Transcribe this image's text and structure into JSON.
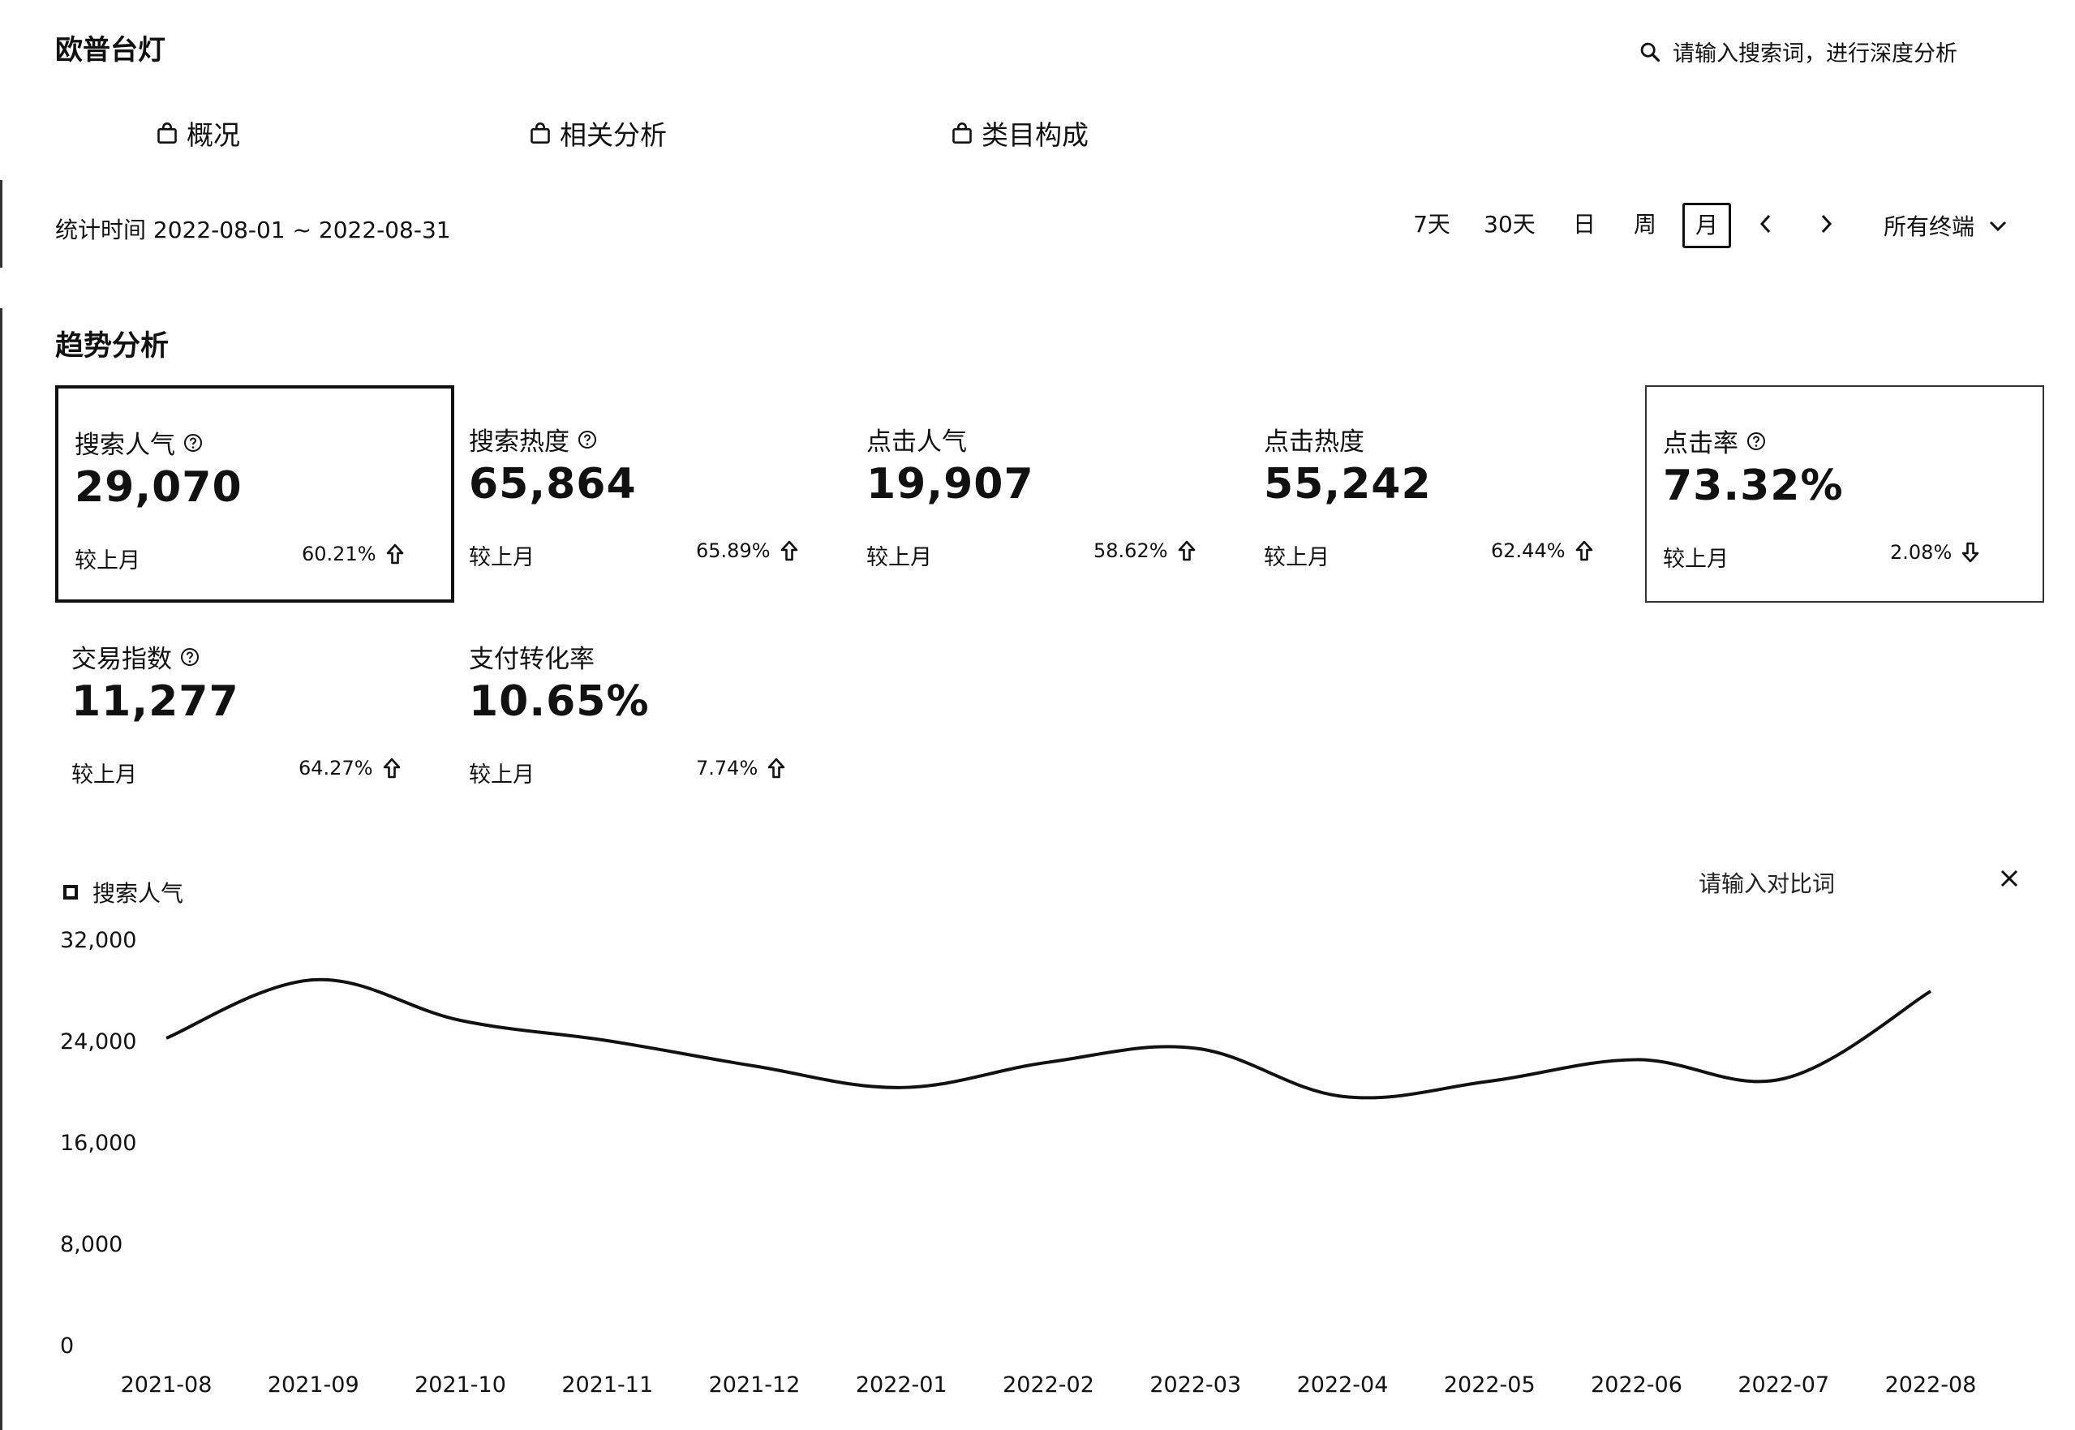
{
  "app": {
    "title": "欧普台灯"
  },
  "search": {
    "placeholder": "请输入搜索词，进行深度分析"
  },
  "tabs": [
    {
      "label": "概况",
      "icon": "shopping-bag-icon"
    },
    {
      "label": "相关分析",
      "icon": "shopping-bag-icon"
    },
    {
      "label": "类目构成",
      "icon": "shopping-bag-icon"
    }
  ],
  "toolbar": {
    "date_range": "统计时间 2022-08-01 ~ 2022-08-31",
    "periods": [
      "7天",
      "30天",
      "日",
      "周",
      "月"
    ],
    "active_period": "月",
    "terminal": "所有终端"
  },
  "section": {
    "title": "趋势分析"
  },
  "metrics": [
    {
      "label": "搜索人气",
      "value": "29,070",
      "compare": "较上月",
      "change": "60.21%",
      "direction": "up",
      "help": true,
      "selected": "primary"
    },
    {
      "label": "搜索热度",
      "value": "65,864",
      "compare": "较上月",
      "change": "65.89%",
      "direction": "up",
      "help": true,
      "selected": "none"
    },
    {
      "label": "点击人气",
      "value": "19,907",
      "compare": "较上月",
      "change": "58.62%",
      "direction": "up",
      "help": false,
      "selected": "none"
    },
    {
      "label": "点击热度",
      "value": "55,242",
      "compare": "较上月",
      "change": "62.44%",
      "direction": "up",
      "help": false,
      "selected": "none"
    },
    {
      "label": "点击率",
      "value": "73.32%",
      "compare": "较上月",
      "change": "2.08%",
      "direction": "down",
      "help": true,
      "selected": "secondary"
    },
    {
      "label": "交易指数",
      "value": "11,277",
      "compare": "较上月",
      "change": "64.27%",
      "direction": "up",
      "help": true,
      "selected": "none"
    },
    {
      "label": "支付转化率",
      "value": "10.65%",
      "compare": "较上月",
      "change": "7.74%",
      "direction": "up",
      "help": false,
      "selected": "none"
    }
  ],
  "chart_controls": {
    "legend_label": "搜索人气",
    "compare_placeholder": "请输入对比词"
  },
  "chart_data": {
    "type": "line",
    "x": [
      "2021-08",
      "2021-09",
      "2021-10",
      "2021-11",
      "2021-12",
      "2022-01",
      "2022-02",
      "2022-03",
      "2022-04",
      "2022-05",
      "2022-06",
      "2022-07",
      "2022-08"
    ],
    "series": [
      {
        "name": "搜索人气",
        "values": [
          24200,
          28800,
          25600,
          24000,
          22000,
          20300,
          22300,
          23400,
          19600,
          20800,
          22500,
          21000,
          27900
        ]
      }
    ],
    "yticks": [
      "0",
      "8,000",
      "16,000",
      "24,000",
      "32,000"
    ],
    "ylim": [
      0,
      32000
    ],
    "grid": false,
    "line_color": "#111111"
  }
}
